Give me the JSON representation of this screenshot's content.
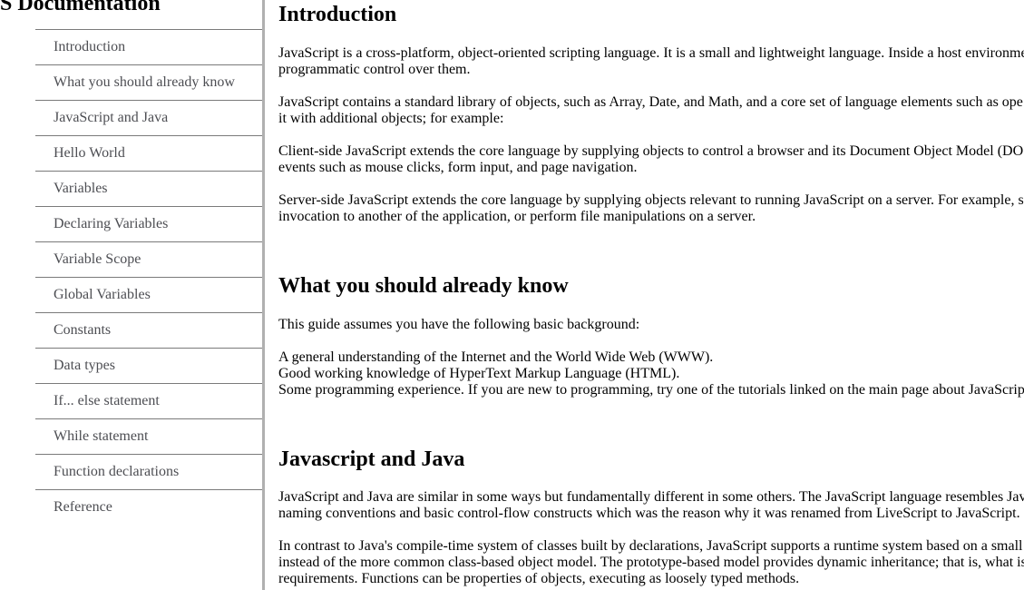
{
  "nav": {
    "header": "JS Documentation",
    "items": [
      "Introduction",
      "What you should already know",
      "JavaScript and Java",
      "Hello World",
      "Variables",
      "Declaring Variables",
      "Variable Scope",
      "Global Variables",
      "Constants",
      "Data types",
      "If... else statement",
      "While statement",
      "Function declarations",
      "Reference"
    ]
  },
  "sections": {
    "intro": {
      "title": "Introduction",
      "p1_l1": "JavaScript is a cross-platform, object-oriented scripting language. It is a small and lightweight language. Inside a host environme",
      "p1_l2": "programmatic control over them.",
      "p2_l1": "JavaScript contains a standard library of objects, such as Array, Date, and Math, and a core set of language elements such as ope",
      "p2_l2": "it with additional objects; for example:",
      "p3_l1": "Client-side JavaScript extends the core language by supplying objects to control a browser and its Document Object Model (DO",
      "p3_l2": "events such as mouse clicks, form input, and page navigation.",
      "p4_l1": "Server-side JavaScript extends the core language by supplying objects relevant to running JavaScript on a server. For example, s",
      "p4_l2": "invocation to another of the application, or perform file manipulations on a server."
    },
    "know": {
      "title": "What you should already know",
      "p1": "This guide assumes you have the following basic background:",
      "items": [
        "A general understanding of the Internet and the World Wide Web (WWW).",
        "Good working knowledge of HyperText Markup Language (HTML).",
        "Some programming experience. If you are new to programming, try one of the tutorials linked on the main page about JavaScrip"
      ]
    },
    "java": {
      "title": "Javascript and Java",
      "p1_l1": "JavaScript and Java are similar in some ways but fundamentally different in some others. The JavaScript language resembles Jav",
      "p1_l2": "naming conventions and basic control-flow constructs which was the reason why it was renamed from LiveScript to JavaScript.",
      "p2_l1": "In contrast to Java's compile-time system of classes built by declarations, JavaScript supports a runtime system based on a small",
      "p2_l2": "instead of the more common class-based object model. The prototype-based model provides dynamic inheritance; that is, what is",
      "p2_l3": "requirements. Functions can be properties of objects, executing as loosely typed methods."
    }
  }
}
